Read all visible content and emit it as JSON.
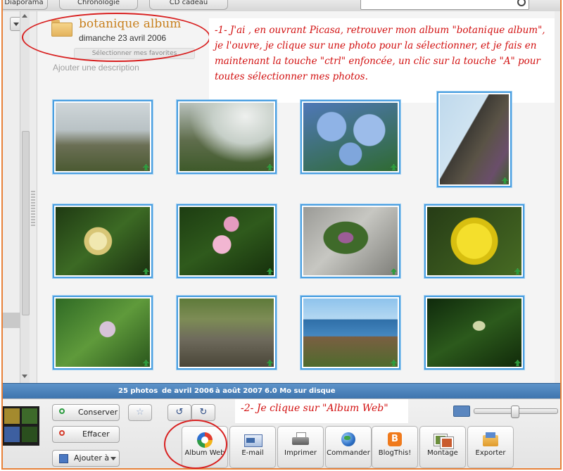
{
  "top": {
    "tabs": [
      "Diaporama",
      "Chronologie",
      "CD cadeau"
    ]
  },
  "album": {
    "title": "botanique album",
    "date": "dimanche 23 avril 2006",
    "select_favorites": "Sélectionner mes favorites",
    "add_description": "Ajouter une description"
  },
  "annotation1": "-1- J'ai , en ouvrant Picasa, retrouver mon album \"botanique album\", je l'ouvre, je clique sur une photo pour la sélectionner, et je fais en maintenant la touche \"ctrl\" enfoncée, un clic sur la touche \"A\" pour toutes sélectionner mes photos.",
  "annotation2": "-2- Je clique sur \"Album Web\"",
  "photos": [
    {
      "name": "misty-hillside"
    },
    {
      "name": "trees-in-fog"
    },
    {
      "name": "blue-hydrangeas"
    },
    {
      "name": "rock-spire-coast"
    },
    {
      "name": "honeysuckle"
    },
    {
      "name": "pink-bramble-flowers"
    },
    {
      "name": "purple-flowers-rock"
    },
    {
      "name": "yellow-flowers"
    },
    {
      "name": "clover-grass"
    },
    {
      "name": "rocky-path"
    },
    {
      "name": "coastline-sea"
    },
    {
      "name": "grass-spikelet"
    }
  ],
  "status": {
    "count": "25 photos",
    "range_start": "de avril 2006",
    "range_end": "à août 2007",
    "size": "6.0 Mo sur disque"
  },
  "tray": {
    "keep_label": "Conserver",
    "clear_label": "Effacer",
    "add_to_label": "Ajouter à",
    "actions": [
      "Album Web",
      "E-mail",
      "Imprimer",
      "Commander",
      "BlogThis!",
      "Montage",
      "Exporter"
    ]
  },
  "colors": {
    "accent_red": "#d21010",
    "album_title": "#c8801e",
    "selection_border": "#4a9fe0",
    "status_bar": "#4f85bd"
  }
}
